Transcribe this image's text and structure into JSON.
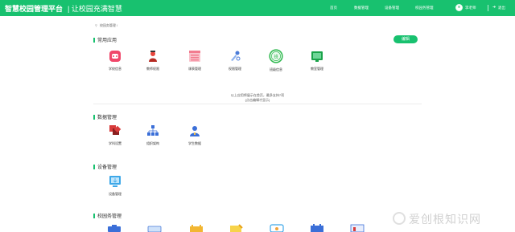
{
  "header": {
    "brand": "智慧校园管理平台",
    "slogan": "| 让校园充满智慧",
    "nav": [
      "首页",
      "数据管理",
      "设备管理",
      "校园务管理"
    ],
    "user": "李老师",
    "logout": "退出",
    "bg_color": "#18c16f"
  },
  "breadcrumb": {
    "icon": "location-pin-icon",
    "text": "校园务管理 /"
  },
  "sections": {
    "common": {
      "title": "常用应用",
      "edit_label": "编辑",
      "apps": [
        {
          "label": "学校信息",
          "icon": "school-info-icon",
          "color": "#f0476a"
        },
        {
          "label": "教师权限",
          "icon": "teacher-icon",
          "color": "#e8453c"
        },
        {
          "label": "课表管理",
          "icon": "schedule-icon",
          "color": "#f27b8f"
        },
        {
          "label": "权限管理",
          "icon": "permission-icon",
          "color": "#4a7bd8"
        },
        {
          "label": "班级信息",
          "icon": "class-info-icon",
          "color": "#2db84d"
        },
        {
          "label": "教室管理",
          "icon": "classroom-icon",
          "color": "#1aa34a"
        }
      ],
      "hint_line1": "以上应用将展示在首页，最多支持7项",
      "hint_line2": "(点击编辑才显示)"
    },
    "data": {
      "title": "数据管理",
      "apps": [
        {
          "label": "学科设置",
          "icon": "subject-settings-icon",
          "color": "#d83b3b"
        },
        {
          "label": "组织架构",
          "icon": "org-structure-icon",
          "color": "#3b6fd8"
        },
        {
          "label": "学生数据",
          "icon": "student-data-icon",
          "color": "#3b6fd8"
        }
      ]
    },
    "device": {
      "title": "设备管理",
      "apps": [
        {
          "label": "设备管理",
          "icon": "device-icon",
          "color": "#3ea8e8"
        }
      ]
    },
    "affairs": {
      "title": "校园务管理"
    }
  },
  "watermark": "爱创根知识网"
}
